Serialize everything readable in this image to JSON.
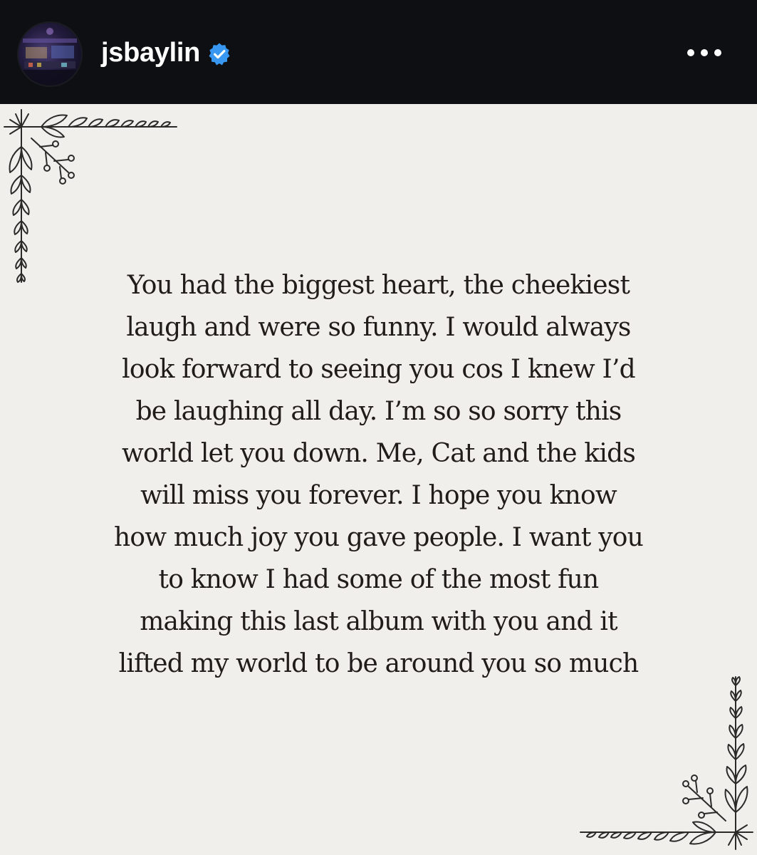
{
  "header": {
    "username": "jsbaylin",
    "verified": true,
    "avatar_icon": "studio-avatar-image",
    "more_icon": "more-options-icon",
    "accent_color": "#3897f0",
    "background_color": "#0d0f13"
  },
  "post": {
    "background_color": "#f1efec",
    "decoration": "botanical-corner-ornaments",
    "message_lines": [
      "You had the biggest heart, the cheekiest",
      "laugh and were so funny. I would always",
      "look forward to seeing you cos I knew I’d",
      "be laughing all day. I’m so so sorry this",
      "world let you down. Me, Cat and the kids",
      "will miss you forever. I hope you know",
      "how much joy you gave people. I want you",
      "to know I had some of the most fun",
      "making this last album with you and it",
      "lifted my world to be around you so much"
    ]
  }
}
